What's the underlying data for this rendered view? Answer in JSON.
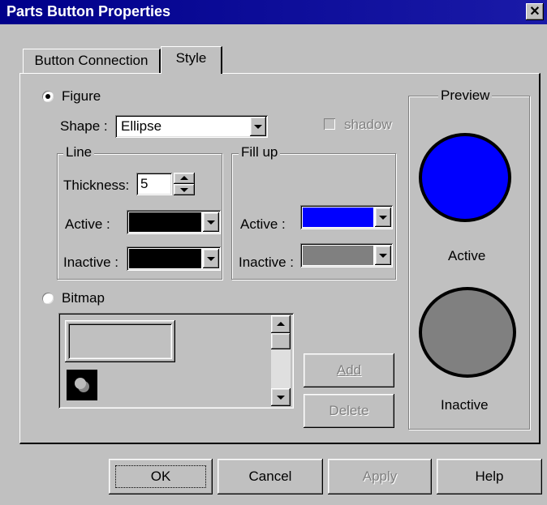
{
  "window": {
    "title": "Parts Button Properties",
    "close_glyph": "✕"
  },
  "tabs": [
    {
      "label": "Button Connection"
    },
    {
      "label": "Style"
    }
  ],
  "figure": {
    "label": "Figure",
    "shape_label": "Shape :",
    "shape_value": "Ellipse",
    "shadow_label": "shadow"
  },
  "line": {
    "title": "Line",
    "thickness_label": "Thickness:",
    "thickness_value": "5",
    "active_label": "Active :",
    "inactive_label": "Inactive :",
    "active_color": "#000000",
    "inactive_color": "#000000"
  },
  "fill": {
    "title": "Fill up",
    "active_label": "Active :",
    "inactive_label": "Inactive :",
    "active_color": "#0000ff",
    "inactive_color": "#808080"
  },
  "bitmap": {
    "label": "Bitmap",
    "add_label": "Add",
    "delete_label": "Delete"
  },
  "preview": {
    "title": "Preview",
    "active_label": "Active",
    "inactive_label": "Inactive"
  },
  "buttons": {
    "ok": "OK",
    "cancel": "Cancel",
    "apply": "Apply",
    "help": "Help"
  }
}
